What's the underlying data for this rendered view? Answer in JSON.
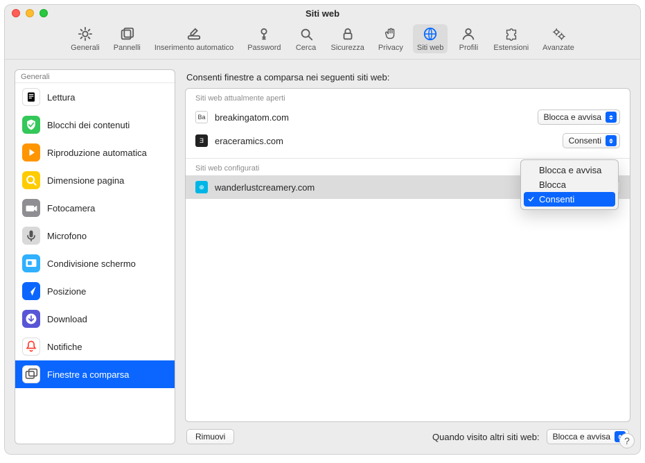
{
  "window": {
    "title": "Siti web"
  },
  "toolbar": {
    "items": [
      {
        "label": "Generali",
        "icon": "gear"
      },
      {
        "label": "Pannelli",
        "icon": "tabs"
      },
      {
        "label": "Inserimento automatico",
        "icon": "pencil"
      },
      {
        "label": "Password",
        "icon": "key"
      },
      {
        "label": "Cerca",
        "icon": "search"
      },
      {
        "label": "Sicurezza",
        "icon": "lock"
      },
      {
        "label": "Privacy",
        "icon": "hand"
      },
      {
        "label": "Siti web",
        "icon": "globe",
        "selected": true
      },
      {
        "label": "Profili",
        "icon": "person"
      },
      {
        "label": "Estensioni",
        "icon": "puzzle"
      },
      {
        "label": "Avanzate",
        "icon": "gears"
      }
    ]
  },
  "sidebar": {
    "header": "Generali",
    "items": [
      {
        "label": "Lettura",
        "icon": "reader",
        "bg": "#ffffff",
        "fg": "#000"
      },
      {
        "label": "Blocchi dei contenuti",
        "icon": "shield",
        "bg": "#34c759",
        "fg": "#fff"
      },
      {
        "label": "Riproduzione automatica",
        "icon": "play",
        "bg": "#ff9500",
        "fg": "#fff"
      },
      {
        "label": "Dimensione pagina",
        "icon": "zoom",
        "bg": "#ffcc00",
        "fg": "#fff"
      },
      {
        "label": "Fotocamera",
        "icon": "camera",
        "bg": "#8e8e93",
        "fg": "#fff"
      },
      {
        "label": "Microfono",
        "icon": "mic",
        "bg": "#d9d9d9",
        "fg": "#555"
      },
      {
        "label": "Condivisione schermo",
        "icon": "screen",
        "bg": "#30b0ff",
        "fg": "#fff"
      },
      {
        "label": "Posizione",
        "icon": "location",
        "bg": "#0a66ff",
        "fg": "#fff"
      },
      {
        "label": "Download",
        "icon": "download",
        "bg": "#5856d6",
        "fg": "#fff"
      },
      {
        "label": "Notifiche",
        "icon": "bell",
        "bg": "#ffffff",
        "fg": "#ff3b30"
      },
      {
        "label": "Finestre a comparsa",
        "icon": "popup",
        "bg": "#ffffff",
        "fg": "#5c5c5c",
        "selected": true
      }
    ]
  },
  "main": {
    "heading": "Consenti finestre a comparsa nei seguenti siti web:",
    "section_open": "Siti web attualmente aperti",
    "section_configured": "Siti web configurati",
    "open_sites": [
      {
        "name": "breakingatom.com",
        "value": "Blocca e avvisa",
        "fav_bg": "#fff",
        "fav_fg": "#333",
        "fav_txt": "Ba"
      },
      {
        "name": "eraceramics.com",
        "value": "Consenti",
        "fav_bg": "#222",
        "fav_fg": "#fff",
        "fav_txt": "Ǝ"
      }
    ],
    "configured_sites": [
      {
        "name": "wanderlustcreamery.com",
        "value": "Consenti",
        "fav_bg": "#00b6e6",
        "fav_fg": "#fff",
        "fav_txt": "⊕",
        "selected": true
      }
    ],
    "dropdown": {
      "options": [
        {
          "label": "Blocca e avvisa"
        },
        {
          "label": "Blocca"
        },
        {
          "label": "Consenti",
          "selected": true
        }
      ]
    },
    "remove_label": "Rimuovi",
    "other_sites_label": "Quando visito altri siti web:",
    "other_sites_value": "Blocca e avvisa"
  }
}
